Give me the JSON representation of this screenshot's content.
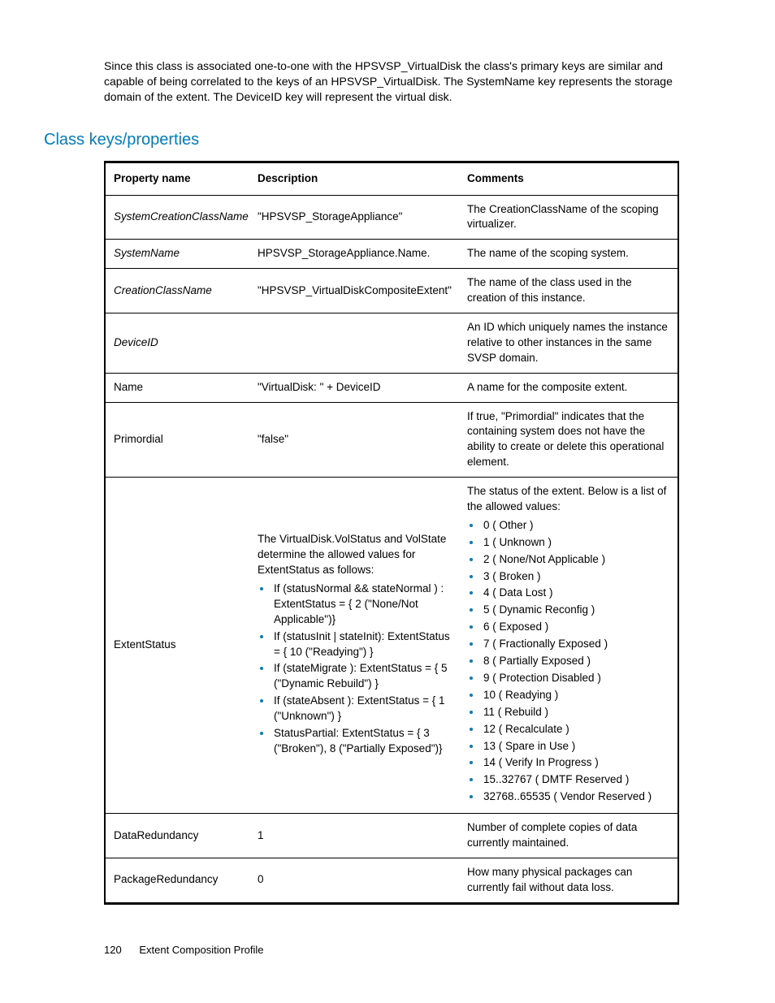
{
  "intro": "Since this class is associated one-to-one with the HPSVSP_VirtualDisk the class's primary keys are similar and capable of being correlated to the keys of an HPSVSP_VirtualDisk. The SystemName key represents the storage domain of the extent. The DeviceID key will represent the virtual disk.",
  "section_heading": "Class keys/properties",
  "columns": [
    "Property name",
    "Description",
    "Comments"
  ],
  "rows": [
    {
      "name": "SystemCreationClassName",
      "name_italic": true,
      "desc": "\"HPSVSP_StorageAppliance\"",
      "comment": "The CreationClassName of the scoping virtualizer."
    },
    {
      "name": "SystemName",
      "name_italic": true,
      "desc": "HPSVSP_StorageAppliance.Name.",
      "comment": "The name of the scoping system."
    },
    {
      "name": "CreationClassName",
      "name_italic": true,
      "desc": "\"HPSVSP_VirtualDiskCompositeExtent\"",
      "comment": "The name of the class used in the creation of this instance."
    },
    {
      "name": "DeviceID",
      "name_italic": true,
      "desc": "",
      "comment": "An ID which uniquely names the instance relative to other instances in the same SVSP domain."
    },
    {
      "name": "Name",
      "name_italic": false,
      "desc": "\"VirtualDisk: \" + DeviceID",
      "comment": "A name for the composite extent."
    },
    {
      "name": "Primordial",
      "name_italic": false,
      "desc": "\"false\"",
      "comment": "If true, \"Primordial\" indicates that the containing system does not have the ability to create or delete this operational element."
    },
    {
      "name": "ExtentStatus",
      "name_italic": false,
      "desc_intro": "The VirtualDisk.VolStatus and VolState determine the allowed values for ExtentStatus as follows:",
      "desc_list": [
        "If (statusNormal && stateNormal ) : ExtentStatus = { 2 (\"None/Not Applicable\")}",
        "If (statusInit | stateInit): ExtentStatus = { 10 (\"Readying\") }",
        "If (stateMigrate ): ExtentStatus = { 5 (\"Dynamic Rebuild\") }",
        "If (stateAbsent ): ExtentStatus = { 1 (\"Unknown\") }",
        "StatusPartial: ExtentStatus = { 3 (\"Broken\"), 8 (\"Partially Exposed\")}"
      ],
      "comment_intro": "The status of the extent. Below is a list of the allowed values:",
      "comment_list": [
        "0 ( Other )",
        "1 ( Unknown )",
        "2 ( None/Not Applicable )",
        "3 ( Broken )",
        "4 ( Data Lost )",
        "5 ( Dynamic Reconfig )",
        "6 ( Exposed )",
        "7 ( Fractionally Exposed )",
        "8 ( Partially Exposed )",
        "9 ( Protection Disabled )",
        "10 ( Readying )",
        "11 ( Rebuild )",
        "12 ( Recalculate )",
        "13 ( Spare in Use )",
        "14 ( Verify In Progress )",
        "15..32767 ( DMTF Reserved )",
        "32768..65535 ( Vendor Reserved )"
      ]
    },
    {
      "name": "DataRedundancy",
      "name_italic": false,
      "desc": "1",
      "comment": "Number of complete copies of data currently maintained."
    },
    {
      "name": "PackageRedundancy",
      "name_italic": false,
      "desc": "0",
      "comment": "How many physical packages can currently fail without data loss."
    }
  ],
  "footer": {
    "page": "120",
    "title": "Extent Composition Profile"
  }
}
